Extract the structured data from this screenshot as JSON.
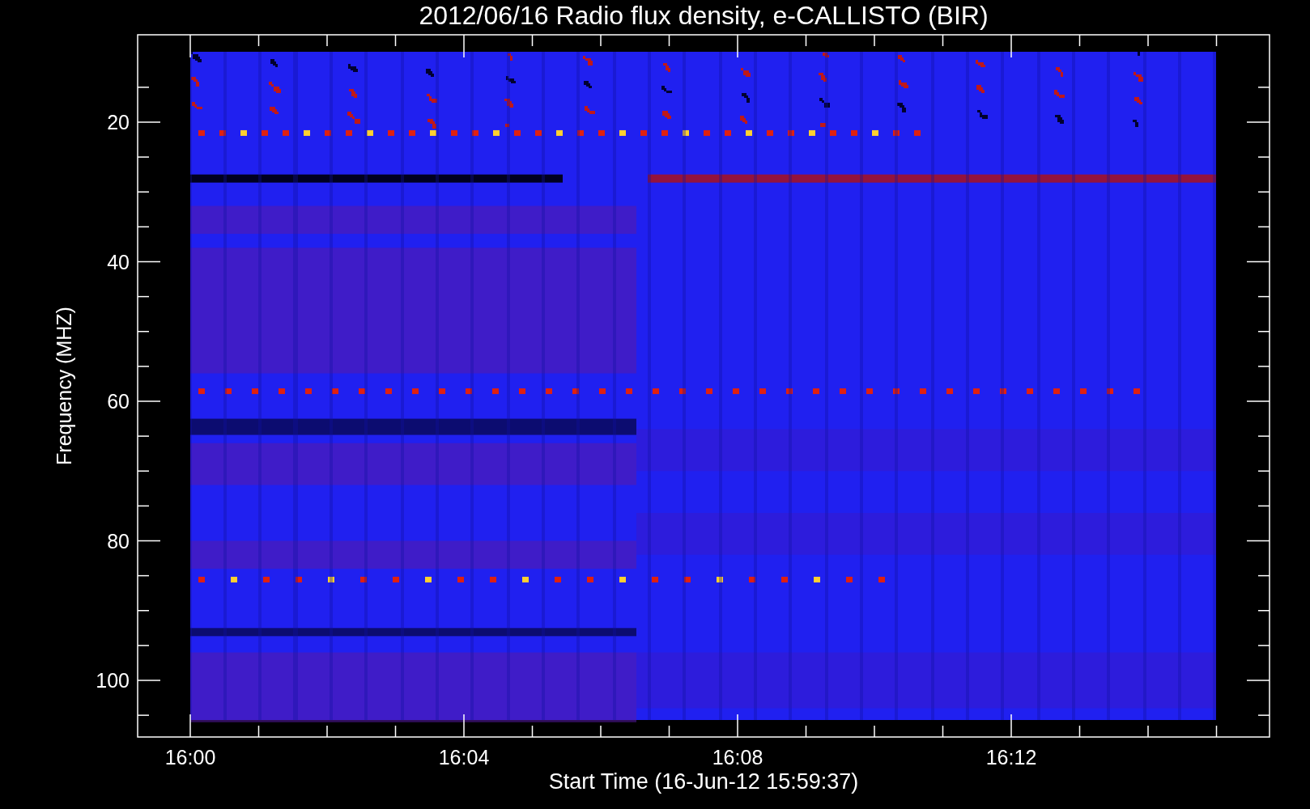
{
  "title": "2012/06/16  Radio flux density, e-CALLISTO (BIR)",
  "plot": {
    "ylabel": "Frequency (MHZ)",
    "xlabel": "Start Time (16-Jun-12 15:59:37)",
    "yticks": [
      "20",
      "40",
      "60",
      "80",
      "100"
    ],
    "xticks": [
      "16:00",
      "16:04",
      "16:08",
      "16:12"
    ]
  }
}
